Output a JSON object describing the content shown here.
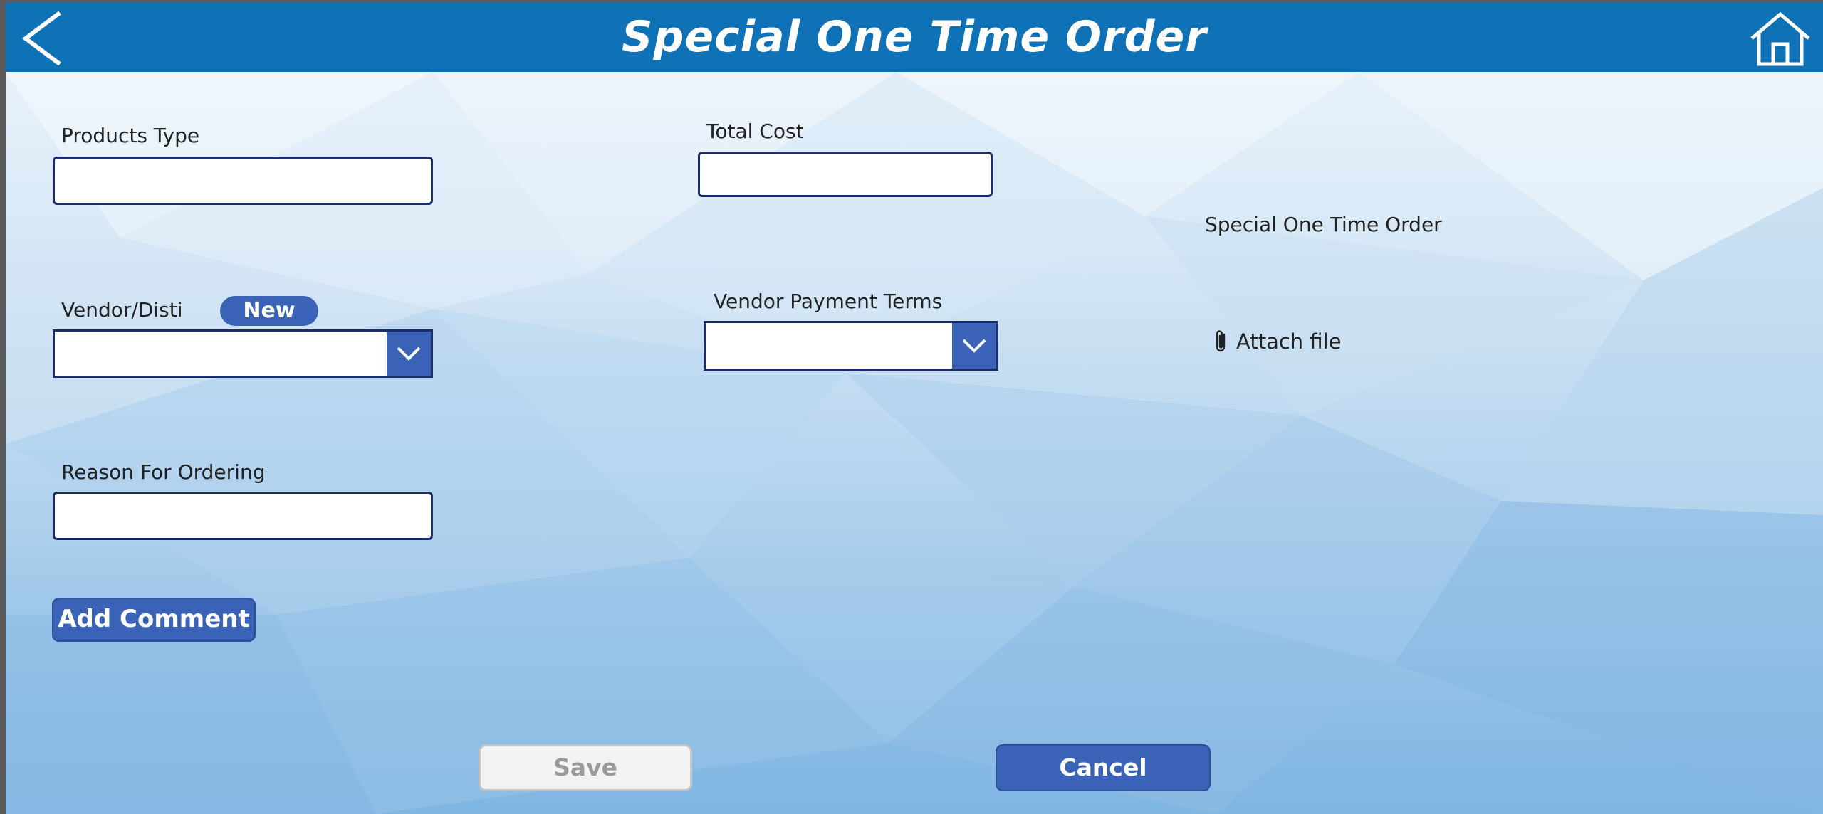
{
  "header": {
    "title": "Special One Time Order"
  },
  "form": {
    "products_type_label": "Products Type",
    "products_type_value": "",
    "total_cost_label": "Total Cost",
    "total_cost_value": "",
    "vendor_label": "Vendor/Disti",
    "vendor_new_label": "New",
    "vendor_value": "",
    "payment_terms_label": "Vendor Payment Terms",
    "payment_terms_value": "",
    "reason_label": "Reason For Ordering",
    "reason_value": "",
    "attachments_title": "Special One Time Order",
    "attach_label": "Attach file"
  },
  "buttons": {
    "add_comment": "Add Comment",
    "save": "Save",
    "cancel": "Cancel"
  },
  "icons": {
    "back": "chevron-left-icon",
    "home": "home-icon",
    "dropdown": "chevron-down-icon",
    "attach": "paperclip-icon"
  },
  "colors": {
    "header_bg": "#0f72b7",
    "accent": "#3a63b8",
    "field_border": "#1b2d6b",
    "disabled_bg": "#f3f3f3",
    "disabled_text": "#9a9a9a"
  }
}
